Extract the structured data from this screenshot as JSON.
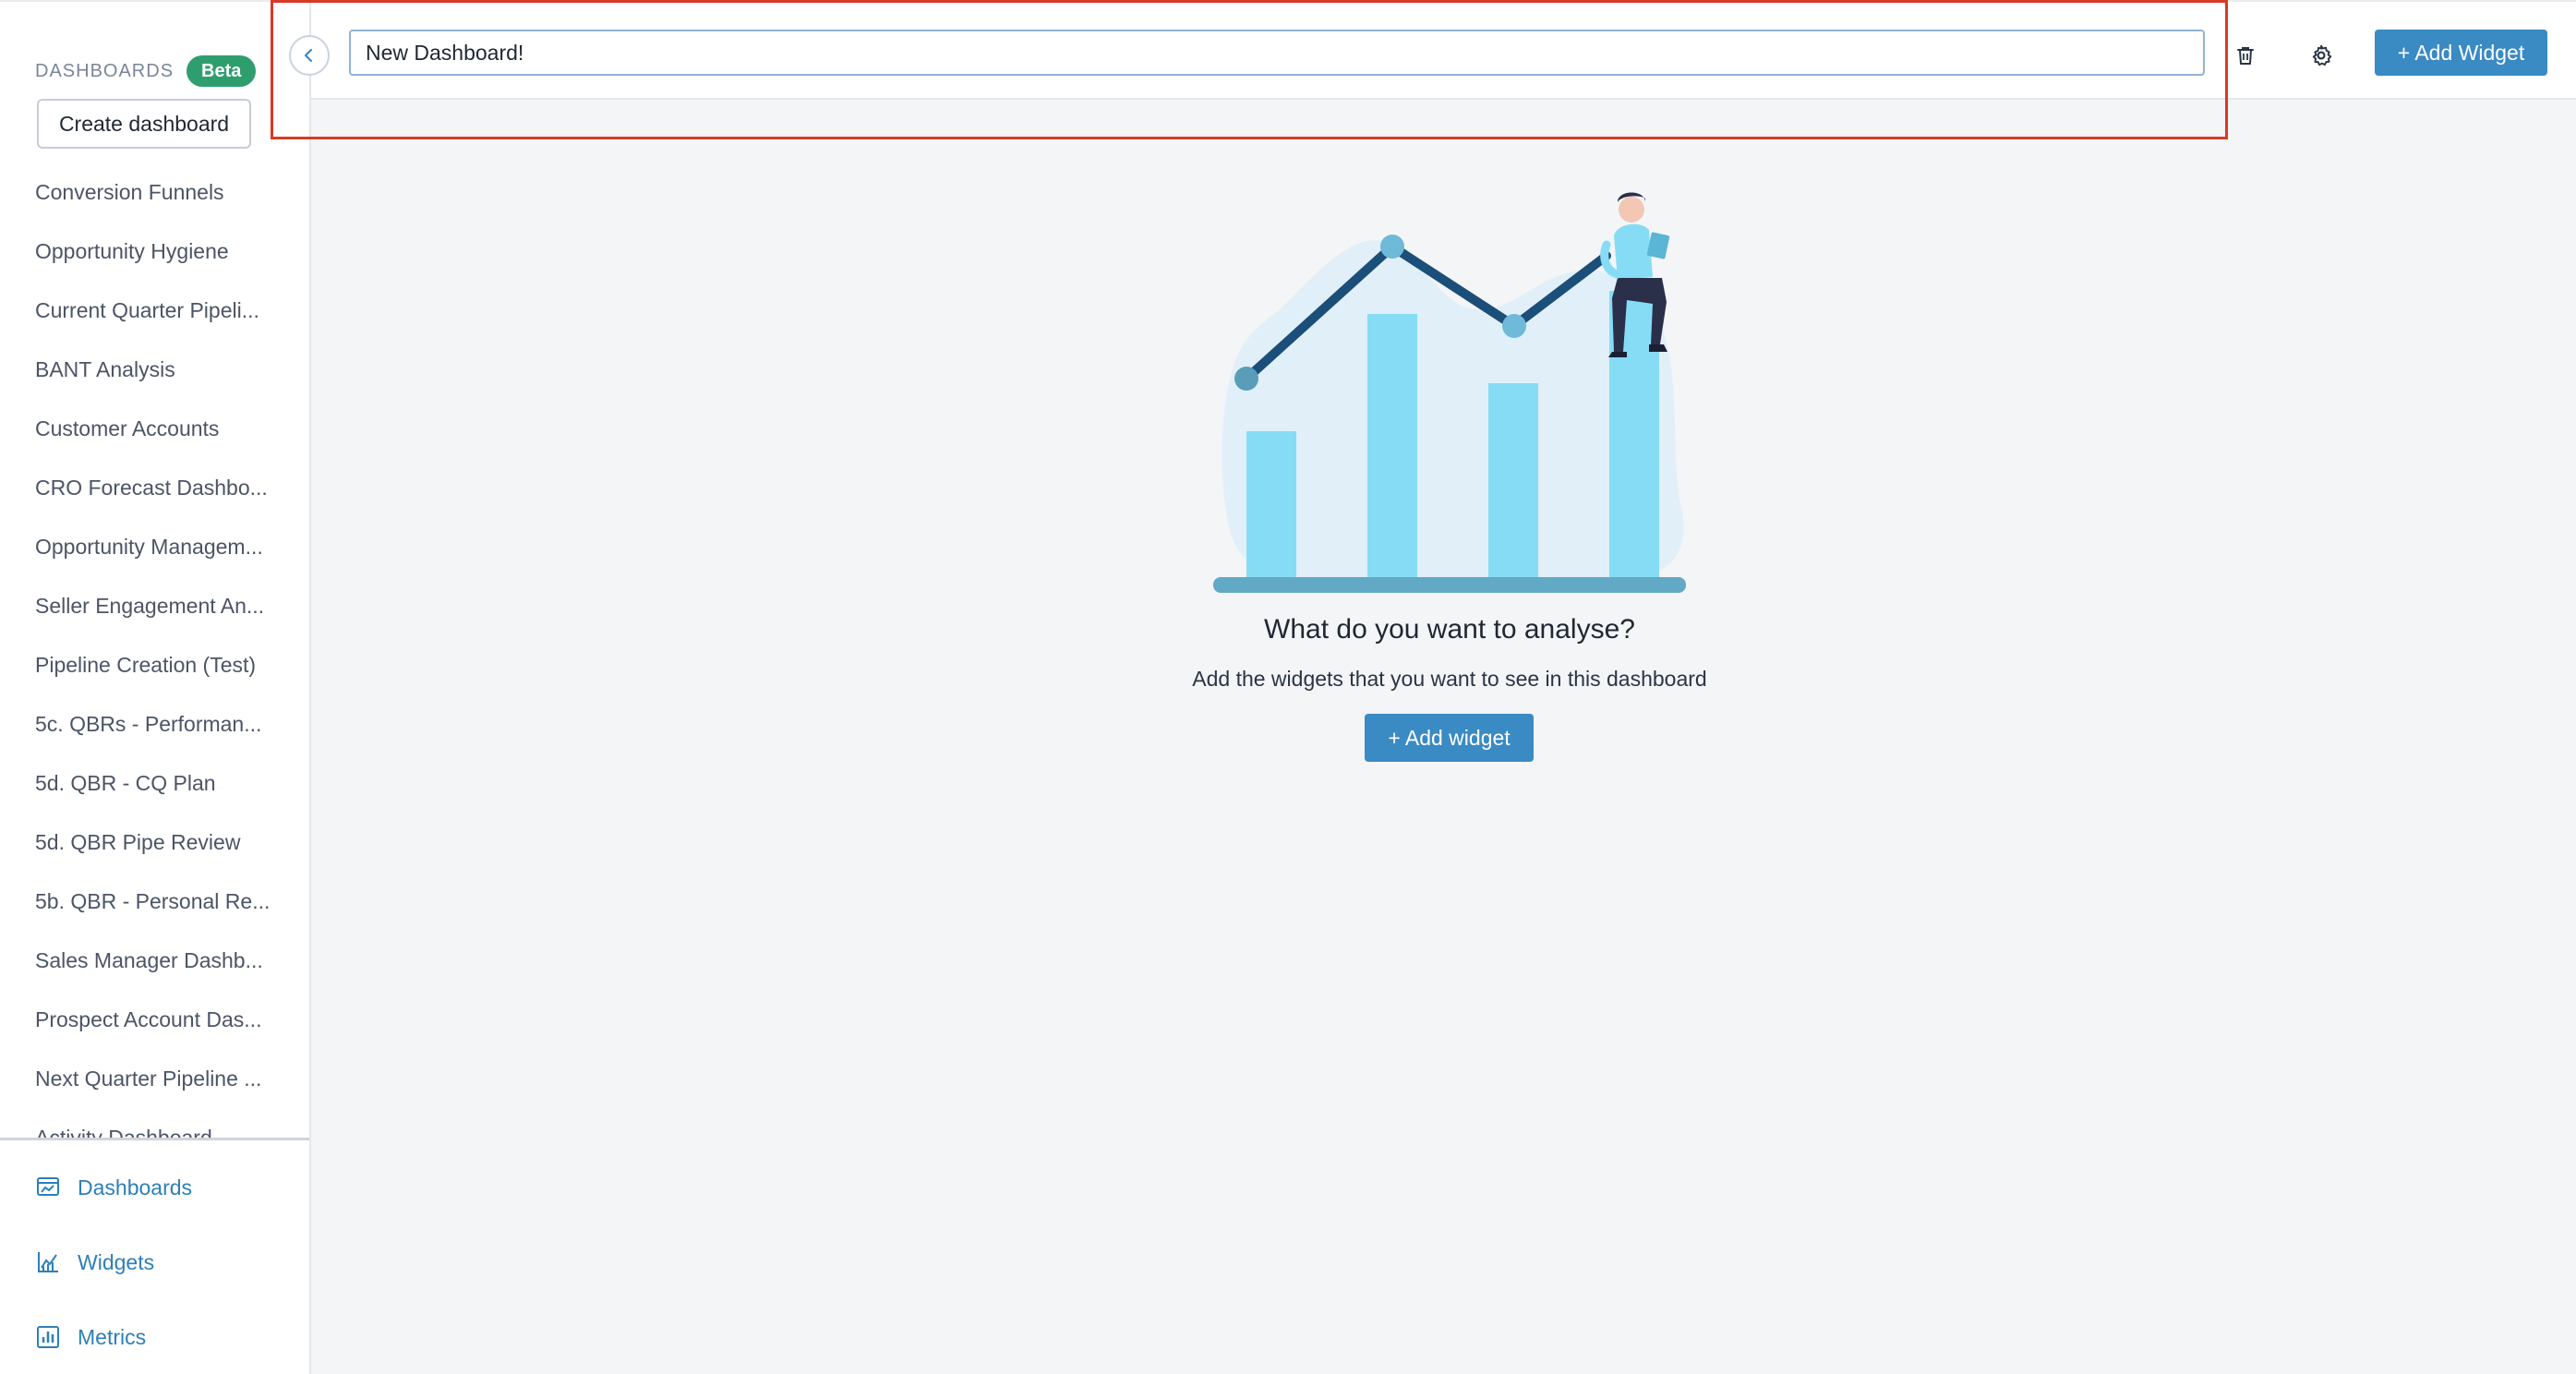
{
  "sidebar": {
    "title": "DASHBOARDS",
    "badge": "Beta",
    "create_label": "Create dashboard",
    "items": [
      "Conversion Funnels",
      "Opportunity Hygiene",
      "Current Quarter Pipeli...",
      "BANT Analysis",
      "Customer Accounts",
      "CRO Forecast Dashbo...",
      "Opportunity Managem...",
      "Seller Engagement An...",
      "Pipeline Creation (Test)",
      "5c. QBRs - Performan...",
      "5d. QBR - CQ Plan",
      "5d. QBR Pipe Review",
      "5b. QBR - Personal Re...",
      "Sales Manager Dashb...",
      "Prospect Account Das...",
      "Next Quarter Pipeline ...",
      "Activity Dashboard"
    ],
    "nav": {
      "dashboards": "Dashboards",
      "widgets": "Widgets",
      "metrics": "Metrics"
    }
  },
  "header": {
    "title_value": "New Dashboard!",
    "add_widget_label": "+ Add Widget"
  },
  "empty_state": {
    "title": "What do you want to analyse?",
    "subtitle": "Add the widgets that you want to see in this dashboard",
    "button_label": "+ Add widget"
  },
  "icons": {
    "collapse": "chevron-left-icon",
    "delete": "trash-icon",
    "settings": "gear-icon"
  },
  "colors": {
    "accent": "#3a8ac4",
    "badge": "#2f9e6e",
    "highlight": "#d93a25",
    "nav_text": "#2d7fb8"
  }
}
